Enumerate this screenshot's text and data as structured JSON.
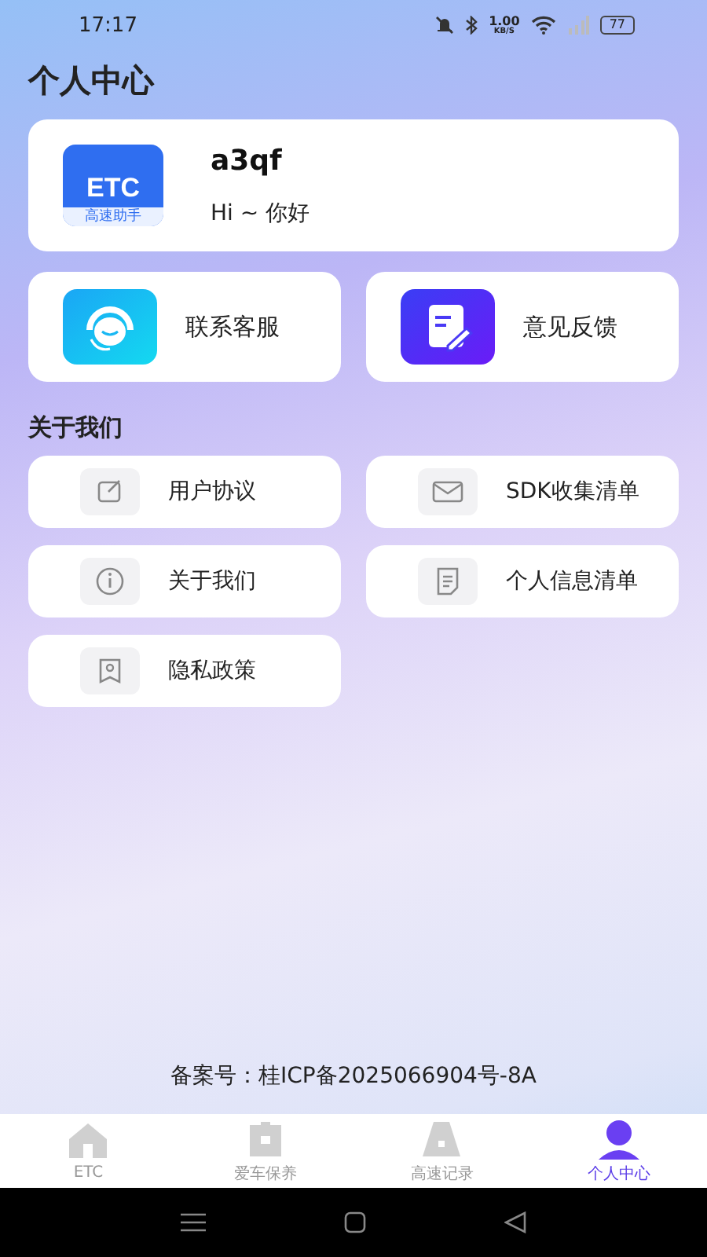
{
  "status_bar": {
    "time": "17:17",
    "net_speed": "1.00",
    "net_unit": "KB/S",
    "battery": "77"
  },
  "title": "个人中心",
  "profile": {
    "name": "a3qf",
    "greeting": "Hi ~ 你好",
    "logo_text": "ETC",
    "logo_caption": "高速助手"
  },
  "quick_actions": [
    {
      "kind": "service",
      "label": "联系客服"
    },
    {
      "kind": "feedback",
      "label": "意见反馈"
    }
  ],
  "section_title": "关于我们",
  "links": [
    {
      "kind": "agreement",
      "label": "用户协议"
    },
    {
      "kind": "sdk",
      "label": "SDK收集清单"
    },
    {
      "kind": "about",
      "label": "关于我们"
    },
    {
      "kind": "info",
      "label": "个人信息清单"
    },
    {
      "kind": "privacy",
      "label": "隐私政策"
    }
  ],
  "footer": "备案号：桂ICP备2025066904号-8A",
  "tabs": [
    {
      "kind": "home",
      "label": "ETC",
      "selected": false
    },
    {
      "kind": "car",
      "label": "爱车保养",
      "selected": false
    },
    {
      "kind": "road",
      "label": "高速记录",
      "selected": false
    },
    {
      "kind": "user",
      "label": "个人中心",
      "selected": true
    }
  ]
}
